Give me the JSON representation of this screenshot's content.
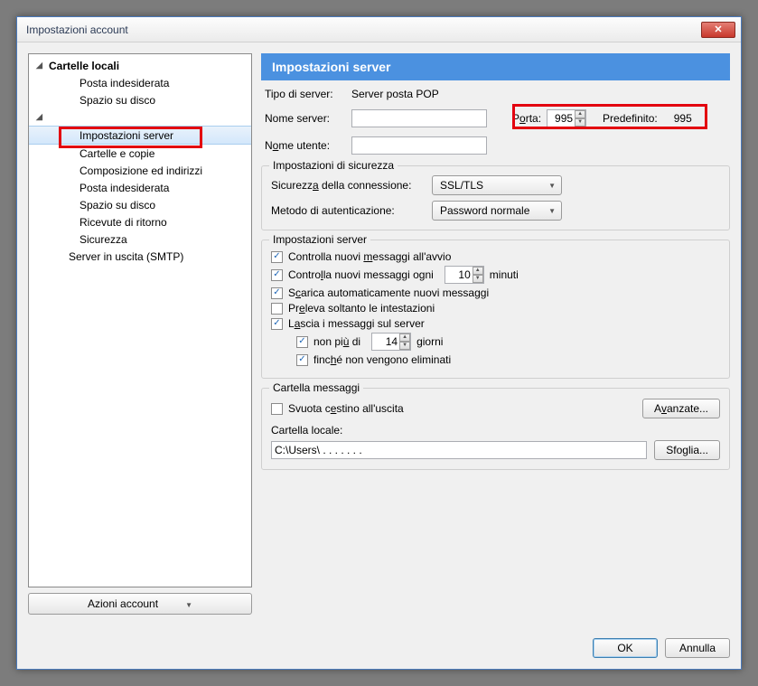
{
  "window": {
    "title": "Impostazioni account",
    "close_glyph": "✕"
  },
  "sidebar": {
    "items": [
      {
        "label": "Cartelle locali",
        "bold": true,
        "twisty": "◢",
        "level": 0
      },
      {
        "label": "Posta indesiderata",
        "level": 2
      },
      {
        "label": "Spazio su disco",
        "level": 2
      },
      {
        "label": "",
        "bold": true,
        "twisty": "◢",
        "level": 0
      },
      {
        "label": "Impostazioni server",
        "level": 2,
        "selected": true
      },
      {
        "label": "Cartelle e copie",
        "level": 2
      },
      {
        "label": "Composizione ed indirizzi",
        "level": 2
      },
      {
        "label": "Posta indesiderata",
        "level": 2
      },
      {
        "label": "Spazio su disco",
        "level": 2
      },
      {
        "label": "Ricevute di ritorno",
        "level": 2
      },
      {
        "label": "Sicurezza",
        "level": 2
      },
      {
        "label": "Server in uscita (SMTP)",
        "level": "2b"
      }
    ],
    "actions_label": "Azioni account"
  },
  "main": {
    "header": "Impostazioni server",
    "server_type_label": "Tipo di server:",
    "server_type_value": "Server posta POP",
    "server_name_label": "Nome server:",
    "server_name_value": "",
    "port_label_pre": "P",
    "port_label_u": "o",
    "port_label_post": "rta:",
    "port_value": "995",
    "default_port_label": "Predefinito:",
    "default_port_value": "995",
    "username_label_pre": "N",
    "username_label_u": "o",
    "username_label_post": "me utente:",
    "username_value": "",
    "security": {
      "legend": "Impostazioni di sicurezza",
      "conn_label_pre": "Sicurezz",
      "conn_label_u": "a",
      "conn_label_post": " della connessione:",
      "conn_value": "SSL/TLS",
      "auth_label": "Metodo di autenticazione:",
      "auth_value": "Password normale"
    },
    "server_settings": {
      "legend": "Impostazioni server",
      "check_startup": "Controlla nuovi messaggi all'avvio",
      "check_every_pre": "Contro",
      "check_every_u": "l",
      "check_every_post": "la nuovi messaggi ogni",
      "check_every_value": "10",
      "minutes": "minuti",
      "auto_dl_pre": "S",
      "auto_dl_u": "c",
      "auto_dl_post": "arica automaticamente nuovi messaggi",
      "headers_only_pre": "Pr",
      "headers_only_u": "e",
      "headers_only_post": "leva soltanto le intestazioni",
      "leave_pre": "L",
      "leave_u": "a",
      "leave_post": "scia i messaggi sul server",
      "atmost_pre": "non pi",
      "atmost_u": "ù",
      "atmost_post": " di",
      "atmost_value": "14",
      "days": "giorni",
      "until_del_pre": "finc",
      "until_del_u": "h",
      "until_del_post": "é non vengono eliminati"
    },
    "folder": {
      "legend": "Cartella messaggi",
      "empty_trash_pre": "Svuota c",
      "empty_trash_u": "e",
      "empty_trash_post": "stino all'uscita",
      "advanced_pre": "A",
      "advanced_u": "v",
      "advanced_post": "anzate...",
      "local_folder_label": "Cartella locale:",
      "local_folder_value": "C:\\Users\\ . . . . . . .",
      "browse_pre": "Sfo",
      "browse_u": "g",
      "browse_post": "lia..."
    }
  },
  "buttons": {
    "ok": "OK",
    "cancel": "Annulla"
  }
}
